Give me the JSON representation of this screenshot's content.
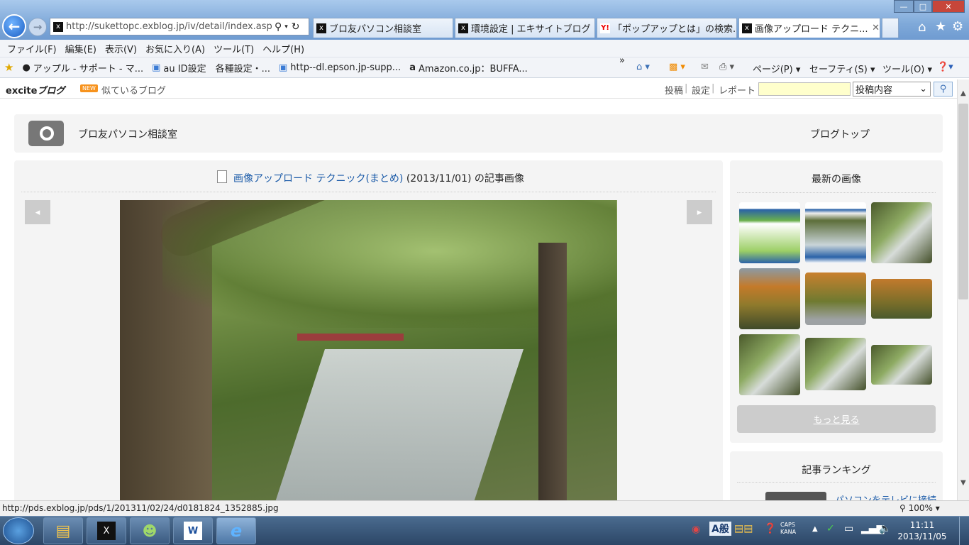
{
  "browser": {
    "url": "http://sukettopc.exblog.jp/iv/detail/index.asp?",
    "tabs": [
      {
        "label": "ブロ友パソコン相談室",
        "active": false
      },
      {
        "label": "環境設定 | エキサイトブログ",
        "active": false
      },
      {
        "label": "「ポップアップとは」の検索...",
        "active": false
      },
      {
        "label": "画像アップロード テクニ...",
        "active": true
      }
    ],
    "menu": [
      "ファイル(F)",
      "編集(E)",
      "表示(V)",
      "お気に入り(A)",
      "ツール(T)",
      "ヘルプ(H)"
    ],
    "favorites": [
      "アップル - サポート - マ...",
      "au ID設定　各種設定・...",
      "http--dl.epson.jp-supp...",
      "Amazon.co.jp：BUFFA..."
    ],
    "commands": {
      "page": "ページ(P)",
      "safety": "セーフティ(S)",
      "tools": "ツール(O)"
    },
    "more": "»"
  },
  "excite_bar": {
    "logo": "excite",
    "logo_suffix": "ブログ",
    "new_badge": "NEW",
    "similar": "似ているブログ",
    "links": [
      "投稿",
      "設定",
      "レポート"
    ],
    "separator": "|",
    "search_placeholder": "",
    "search_scope": "投稿内容"
  },
  "blog": {
    "name": "ブロ友パソコン相談室",
    "top_link": "ブログトップ"
  },
  "article": {
    "title_link": "画像アップロード テクニック(まとめ)",
    "date": "(2013/11/01)",
    "suffix": "の記事画像",
    "prev_label": "◂",
    "next_label": "▸"
  },
  "sidebar": {
    "latest_title": "最新の画像",
    "more_label": "もっと見る",
    "ranking_title": "記事ランキング",
    "ranking_first": "パソコンをテレビに接続..."
  },
  "status": {
    "url": "http://pds.exblog.jp/pds/1/201311/02/24/d0181824_1352885.jpg",
    "zoom": "100%"
  },
  "taskbar": {
    "time": "11:11",
    "date": "2013/11/05",
    "ime_mode": "A",
    "ime_kanji": "般",
    "caps": "CAPS",
    "kana": "KANA"
  },
  "colors": {
    "accent_link": "#1a5aa8",
    "excite_orange": "#f7931e"
  }
}
